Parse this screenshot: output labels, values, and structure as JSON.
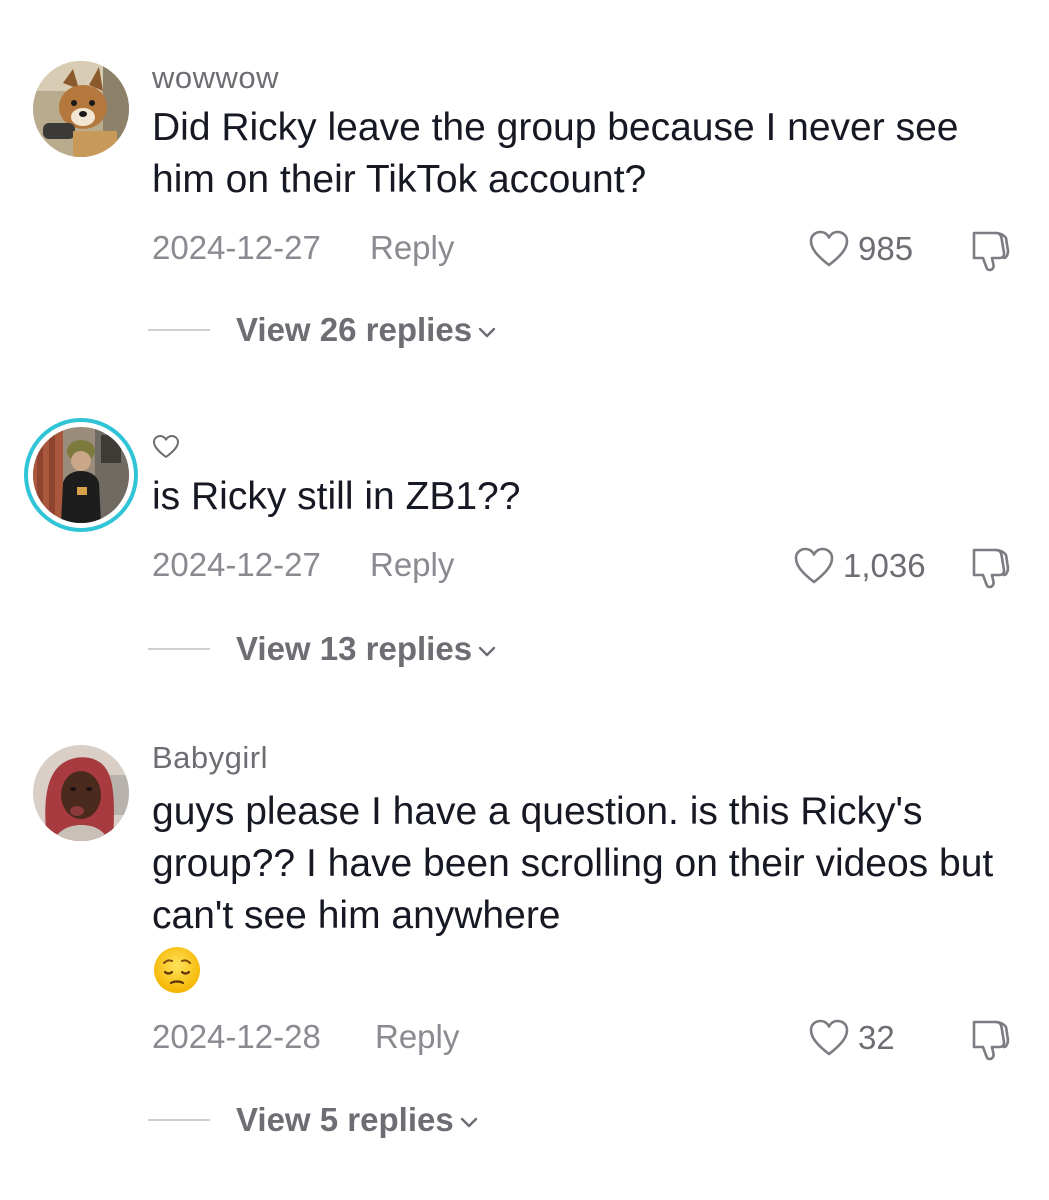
{
  "comments": [
    {
      "username": "wowwow",
      "text": "Did Ricky leave the group because I never see him on their TikTok account?",
      "date": "2024-12-27",
      "reply_label": "Reply",
      "likes": "985",
      "view_replies": "View 26 replies",
      "avatar_icon": "avatar-photo"
    },
    {
      "username": "",
      "username_icon": "heart-outline-icon",
      "text": "is Ricky still in ZB1??",
      "date": "2024-12-27",
      "reply_label": "Reply",
      "likes": "1,036",
      "view_replies": "View 13 replies",
      "avatar_icon": "avatar-photo",
      "avatar_ring_color": "#2fc4d6"
    },
    {
      "username": "Babygirl",
      "text": "guys please I have a question. is this Ricky's group?? I have been scrolling on their videos but can't see him anywhere",
      "emoji": "pensive-face-emoji",
      "date": "2024-12-28",
      "reply_label": "Reply",
      "likes": "32",
      "view_replies": "View 5 replies",
      "avatar_icon": "avatar-photo"
    }
  ],
  "colors": {
    "primary_text": "#161823",
    "secondary_text": "#8a8a90",
    "username_text": "#6d6d73",
    "ring": "#2fc4d6"
  }
}
